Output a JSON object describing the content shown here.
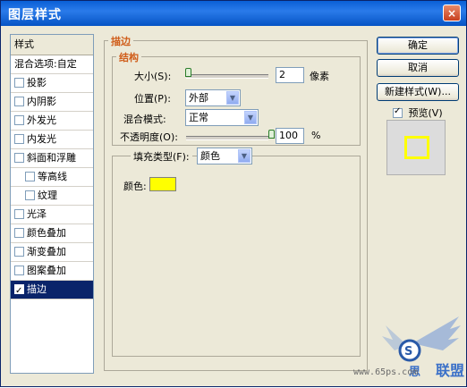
{
  "window": {
    "title": "图层样式",
    "close_glyph": "×"
  },
  "left_panel": {
    "header": "样式",
    "blend_item": "混合选项:自定",
    "items": [
      {
        "label": "投影",
        "checked": false
      },
      {
        "label": "内阴影",
        "checked": false
      },
      {
        "label": "外发光",
        "checked": false
      },
      {
        "label": "内发光",
        "checked": false
      },
      {
        "label": "斜面和浮雕",
        "checked": false
      },
      {
        "label": "等高线",
        "checked": false
      },
      {
        "label": "纹理",
        "checked": false
      },
      {
        "label": "光泽",
        "checked": false
      },
      {
        "label": "颜色叠加",
        "checked": false
      },
      {
        "label": "渐变叠加",
        "checked": false
      },
      {
        "label": "图案叠加",
        "checked": false
      },
      {
        "label": "描边",
        "checked": true
      }
    ]
  },
  "stroke": {
    "group_title": "描边",
    "structure_title": "结构",
    "size_label": "大小(S):",
    "size_value": "2",
    "size_unit": "像素",
    "size_slider": 0.0,
    "position_label": "位置(P):",
    "position_value": "外部",
    "blend_mode_label": "混合模式:",
    "blend_mode_value": "正常",
    "opacity_label": "不透明度(O):",
    "opacity_value": "100",
    "opacity_unit": "%",
    "opacity_slider": 1.0,
    "fill_type_label": "填充类型(F):",
    "fill_type_value": "颜色",
    "color_label": "颜色:",
    "color_value": "#ffff00"
  },
  "buttons": {
    "ok": "确定",
    "cancel": "取消",
    "new_style": "新建样式(W)...",
    "preview_label": "预览(V)",
    "preview_checked": true
  },
  "watermark": {
    "text": "www.65ps.com"
  },
  "colors": {
    "title_bar": "#0a5fd6",
    "selected_item": "#0a246a",
    "group_title": "#d05d1a",
    "stroke_color": "#ffff00"
  }
}
